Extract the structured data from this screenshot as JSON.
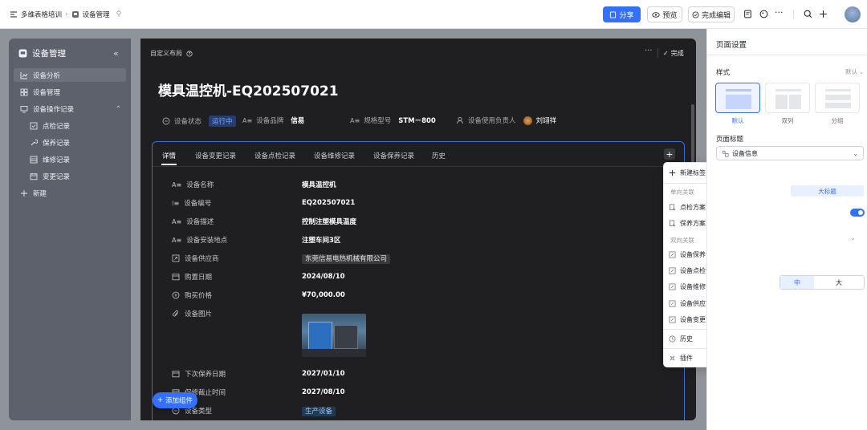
{
  "topbar": {
    "breadcrumb_app": "多维表格培训",
    "breadcrumb_page": "设备管理",
    "share_label": "分享",
    "preview_label": "预览",
    "finish_label": "完成编辑"
  },
  "sidebar": {
    "title": "设备管理",
    "items": [
      {
        "label": "设备分析"
      },
      {
        "label": "设备管理"
      },
      {
        "label": "设备操作记录"
      },
      {
        "label": "点检记录"
      },
      {
        "label": "保养记录"
      },
      {
        "label": "维修记录"
      },
      {
        "label": "变更记录"
      },
      {
        "label": "新建"
      }
    ]
  },
  "card": {
    "layout_label": "自定义布局",
    "done_label": "完成",
    "title": "模具温控机-EQ202507021",
    "header_fields": {
      "status_label": "设备状态",
      "status_value": "运行中",
      "brand_label": "设备品牌",
      "brand_value": "信易",
      "model_label": "规格型号",
      "model_value": "STM－800",
      "owner_label": "设备使用负责人",
      "owner_value": "刘翊祥"
    },
    "tabs": [
      "详情",
      "设备变更记录",
      "设备点检记录",
      "设备维修记录",
      "设备保养记录",
      "历史"
    ],
    "rows": [
      {
        "label": "设备名称",
        "value": "模具温控机"
      },
      {
        "label": "设备编号",
        "value": "EQ202507021"
      },
      {
        "label": "设备描述",
        "value": "控制注塑模具温度"
      },
      {
        "label": "设备安装地点",
        "value": "注塑车间3区"
      },
      {
        "label": "设备供应商",
        "value": "东莞信易电热机械有限公司"
      },
      {
        "label": "购置日期",
        "value": "2024/08/10"
      },
      {
        "label": "购买价格",
        "value": "¥70,000.00"
      },
      {
        "label": "设备图片",
        "value": ""
      },
      {
        "label": "下次保养日期",
        "value": "2027/01/10"
      },
      {
        "label": "保修截止时间",
        "value": "2027/08/10"
      },
      {
        "label": "设备类型",
        "value": "生产设备"
      }
    ],
    "add_component_label": "添加组件"
  },
  "dropdown": {
    "new_tab": "新建标签",
    "group_one_way": "单向关联",
    "one_way": [
      "点检方案",
      "保养方案"
    ],
    "group_two_way": "双向关联",
    "two_way": [
      "设备保养记录",
      "设备点检记录",
      "设备维修记录",
      "设备供应商",
      "设备变更记录"
    ],
    "history": "历史",
    "plugin": "插件"
  },
  "right_panel": {
    "title": "页面设置",
    "style_label": "样式",
    "style_default": "默认",
    "layouts": [
      "默认",
      "双列",
      "分组"
    ],
    "page_title_label": "页面标题",
    "page_title_value": "设备信息",
    "title_size_option": "大标题",
    "size_options": [
      "中",
      "大"
    ]
  },
  "colors": {
    "primary": "#3370ff",
    "sidebar_bg": "#5d616b",
    "card_bg": "#1f1f21",
    "status_running": "#7aa3ff"
  }
}
